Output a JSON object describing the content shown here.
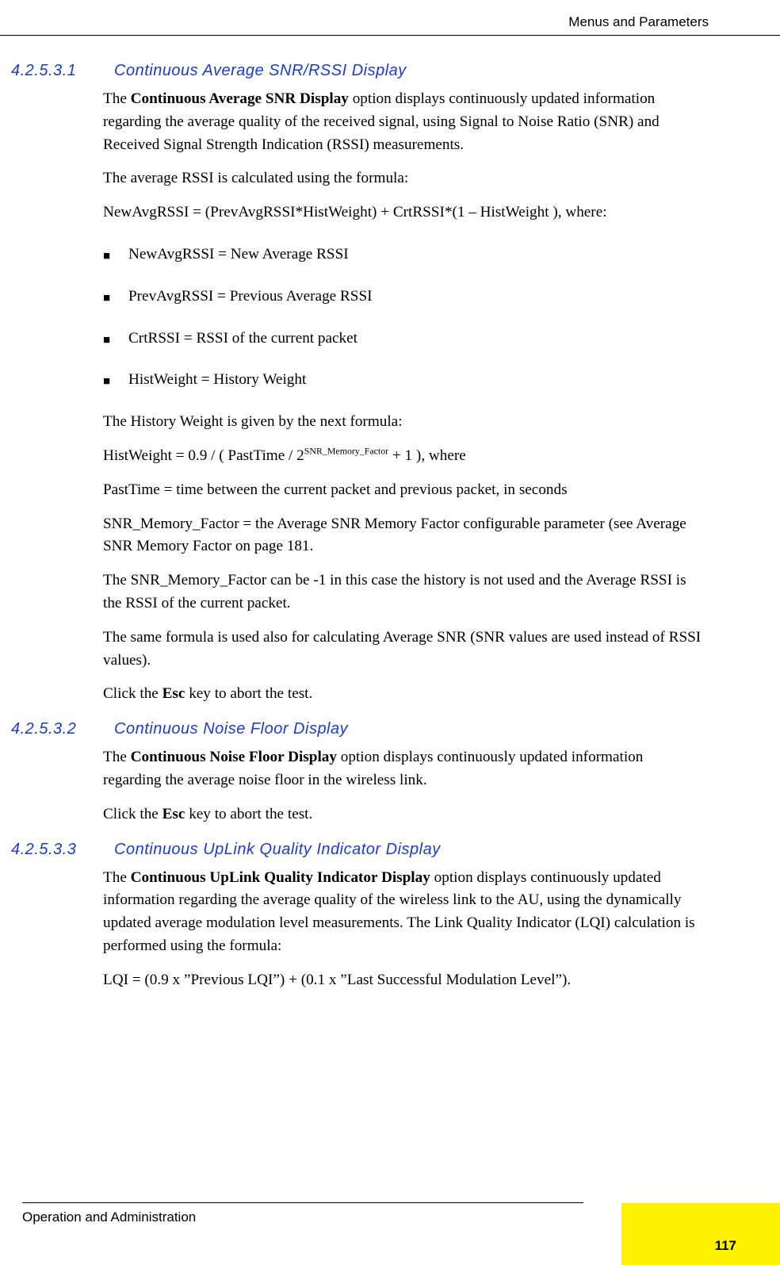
{
  "header": {
    "right": "Menus and Parameters"
  },
  "sections": [
    {
      "num": "4.2.5.3.1",
      "title": "Continuous Average SNR/RSSI Display",
      "p1_a": "The ",
      "p1_b": "Continuous Average SNR Display",
      "p1_c": " option displays continuously updated information regarding the average quality of the received signal, using Signal to Noise Ratio (SNR) and Received Signal Strength Indication (RSSI) measurements.",
      "p2": "The average RSSI is calculated using the formula:",
      "p3": "NewAvgRSSI = (PrevAvgRSSI*HistWeight) + CrtRSSI*(1 – HistWeight ), where:",
      "bullets": [
        "NewAvgRSSI = New Average RSSI",
        "PrevAvgRSSI = Previous Average RSSI",
        "CrtRSSI = RSSI of the current packet",
        "HistWeight = History Weight"
      ],
      "p4": "The History Weight is given by the next formula:",
      "p5a": "HistWeight = 0.9 / ( PastTime / 2",
      "p5sup": "SNR_Memory_Factor",
      "p5b": " + 1 ), where",
      "p6": "PastTime = time between the current packet and previous packet, in seconds",
      "p7": "SNR_Memory_Factor = the Average SNR Memory Factor configurable parameter (see Average SNR Memory Factor on page 181.",
      "p8": "The SNR_Memory_Factor can be -1 in this case the history is not used and the Average RSSI is the RSSI of the current packet.",
      "p9": "The same formula is used also for calculating Average SNR (SNR values are used instead of RSSI values).",
      "p10a": "Click the ",
      "p10b": "Esc",
      "p10c": " key to abort the test."
    },
    {
      "num": "4.2.5.3.2",
      "title": "Continuous Noise Floor Display",
      "p1_a": "The ",
      "p1_b": "Continuous Noise Floor Display",
      "p1_c": " option displays continuously updated information regarding the average noise floor in the wireless link.",
      "p2a": "Click the ",
      "p2b": "Esc",
      "p2c": " key to abort the test."
    },
    {
      "num": "4.2.5.3.3",
      "title": "Continuous UpLink Quality Indicator Display",
      "p1_a": "The ",
      "p1_b": "Continuous UpLink Quality Indicator Display",
      "p1_c": " option displays continuously updated information regarding the average quality of the wireless link to the AU, using the dynamically updated average modulation level measurements. The Link Quality Indicator (LQI) calculation is performed using the formula:",
      "p2": "LQI = (0.9 x ”Previous LQI”) + (0.1 x ”Last Successful Modulation Level”)."
    }
  ],
  "footer": {
    "left": "Operation and Administration",
    "page": "117"
  }
}
